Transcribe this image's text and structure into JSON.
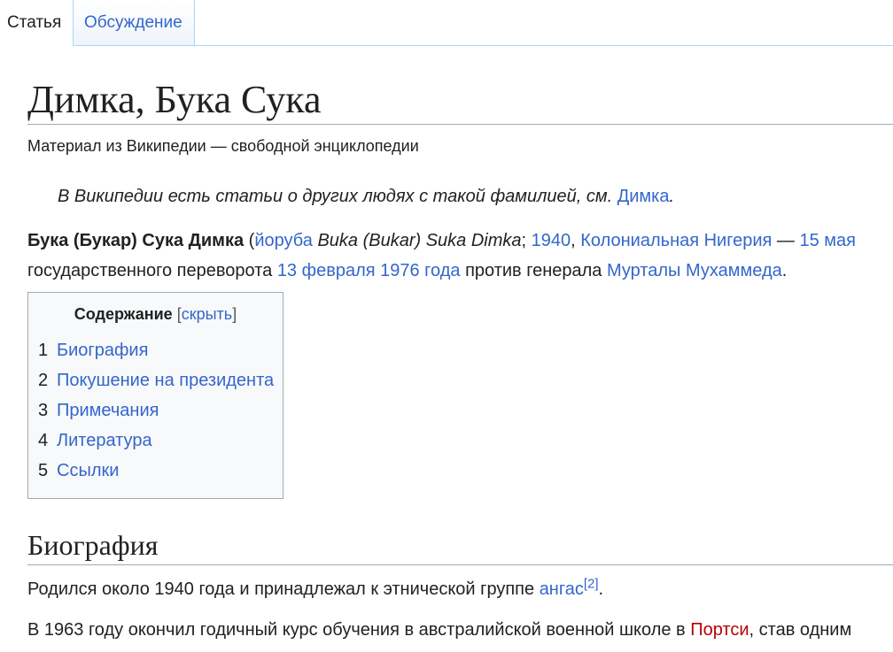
{
  "tabs": {
    "article": "Статья",
    "talk": "Обсуждение"
  },
  "title": "Димка, Бука Сука",
  "tagline": "Материал из Википедии — свободной энциклопедии",
  "hatnote": {
    "text": "В Википедии есть статьи о других людях с такой фамилией, см.",
    "link": "Димка",
    "end": "."
  },
  "lead": {
    "name_bold": "Бука (Букар) Сука Димка",
    "open_paren": " (",
    "lang_link": "йоруба",
    "native_name": "Buka (Bukar) Suka Dimka",
    "semicolon": ";",
    "year_link": "1940",
    "comma": ",",
    "country_link": "Колониальная Нигерия",
    "dash": " — ",
    "date_link": "15 мая",
    "line2_start": "государственного переворота",
    "date2_link": "13 февраля 1976 года",
    "line2_mid": " против генерала ",
    "general_link": "Мурталы Мухаммеда",
    "line2_end": "."
  },
  "toc": {
    "title": "Содержание",
    "toggle_open": "[",
    "toggle_link": "скрыть",
    "toggle_close": "]",
    "items": [
      {
        "num": "1",
        "label": "Биография"
      },
      {
        "num": "2",
        "label": "Покушение на президента"
      },
      {
        "num": "3",
        "label": "Примечания"
      },
      {
        "num": "4",
        "label": "Литература"
      },
      {
        "num": "5",
        "label": "Ссылки"
      }
    ]
  },
  "section": {
    "heading": "Биография",
    "p1_text": "Родился около 1940 года и принадлежал к этнической группе ",
    "p1_link": "ангас",
    "p1_ref": "[2]",
    "p1_end": ".",
    "p2_text": "В 1963 году окончил годичный курс обучения в австралийской военной школе в ",
    "p2_redlink": "Портси",
    "p2_end": ", став одним"
  },
  "colors": {
    "link": "#3366cc",
    "redlink": "#ba0000",
    "text": "#202122",
    "border": "#a2a9b1",
    "tab_border": "#a7d7f9"
  }
}
